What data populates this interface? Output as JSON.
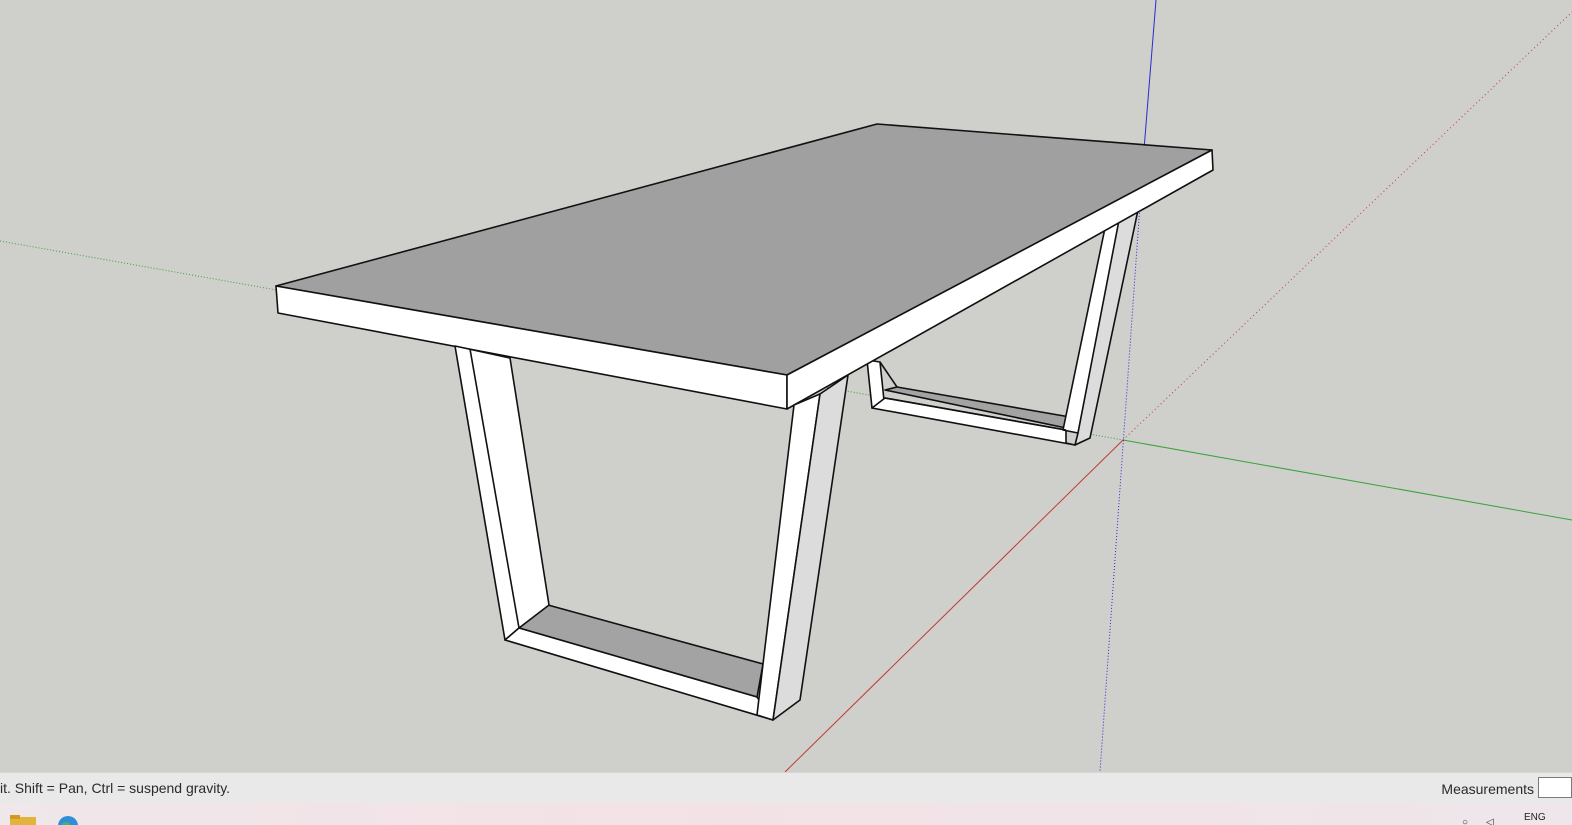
{
  "viewport": {
    "background_color": "#cfcfcc",
    "axis_colors": {
      "red": "#c23a3a",
      "green": "#3aa33a",
      "blue": "#2a2ad0"
    },
    "model": "table"
  },
  "status_bar": {
    "hint_text": "it. Shift = Pan, Ctrl = suspend gravity.",
    "measurements_label": "Measurements",
    "measurements_value": ""
  },
  "taskbar": {
    "apps": [
      {
        "icon": "folder-icon"
      },
      {
        "icon": "globe-icon"
      }
    ],
    "tray": {
      "icons": [
        "search-icon",
        "speaker-icon"
      ],
      "language": "ENG"
    }
  }
}
